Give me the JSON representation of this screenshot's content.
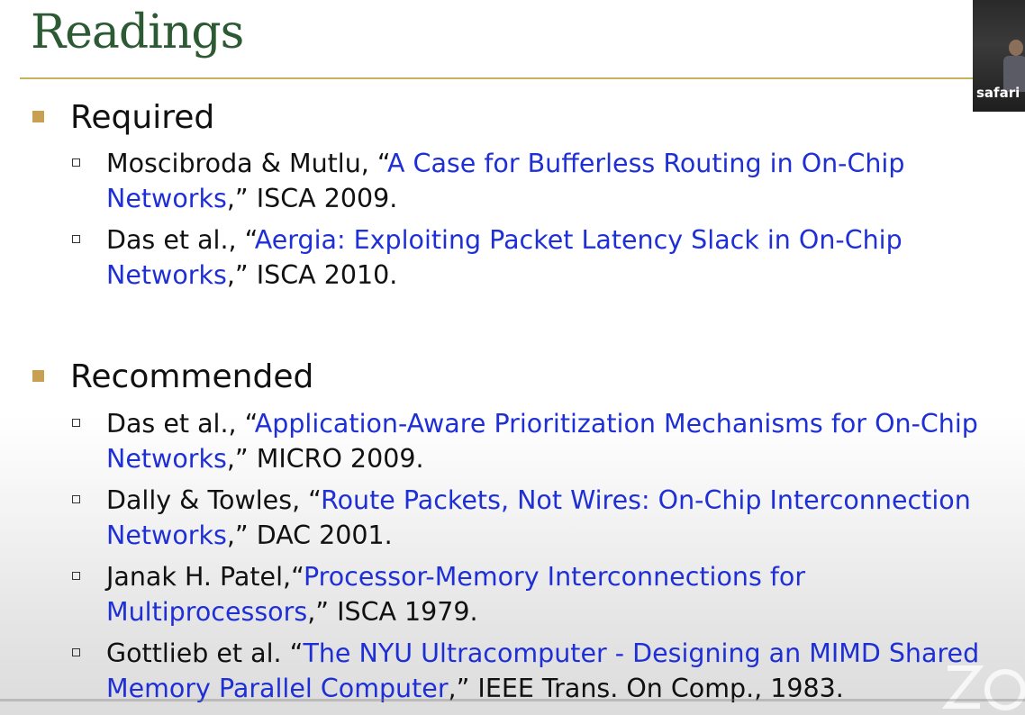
{
  "slide": {
    "title": "Readings"
  },
  "required": {
    "label": "Required",
    "items": [
      {
        "prefix": "Moscibroda & Mutlu, “",
        "link": "A Case for Bufferless Routing in On-Chip Networks",
        "suffix": ",” ISCA 2009."
      },
      {
        "prefix": "Das et al., “",
        "link": "Aergia: Exploiting Packet Latency Slack in On-Chip Networks",
        "suffix": ",” ISCA 2010."
      }
    ]
  },
  "recommended": {
    "label": "Recommended",
    "items": [
      {
        "prefix": "Das et al., “",
        "link": "Application-Aware Prioritization Mechanisms for On-Chip Networks",
        "suffix": ",” MICRO 2009."
      },
      {
        "prefix": "Dally & Towles, “",
        "link": "Route Packets, Not Wires: On-Chip Interconnection Networks",
        "suffix": ",” DAC 2001."
      },
      {
        "prefix": "Janak H. Patel,“",
        "link": "Processor-Memory Interconnections for Multiprocessors",
        "suffix": ",” ISCA 1979."
      },
      {
        "prefix": "Gottlieb et al. “",
        "link": "The NYU Ultracomputer - Designing an MIMD Shared Memory Parallel Computer",
        "suffix": ",” IEEE Trans. On Comp., 1983."
      }
    ]
  },
  "webcam": {
    "label": "safari"
  },
  "colors": {
    "title": "#2c5a33",
    "rule": "#c9b25e",
    "bullet": "#c8a150",
    "link": "#1f2fd6"
  }
}
